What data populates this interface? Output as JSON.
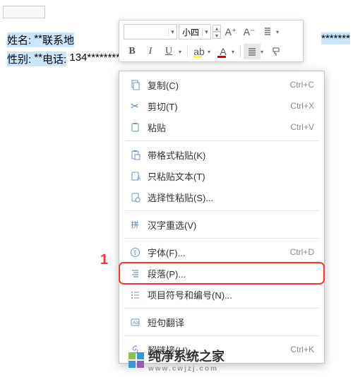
{
  "document": {
    "line1": {
      "name": "姓名:",
      "nv": " **",
      "addr": "联系地"
    },
    "line2": {
      "sex": "性别:",
      "sv": " **",
      "tel": "电话:",
      "num": " 134********"
    },
    "more_stars": "*******"
  },
  "toolbar": {
    "font_name": "",
    "font_size": "小四",
    "inc": "A⁺",
    "dec": "A⁻"
  },
  "menu": {
    "copy": {
      "label": "复制(C)",
      "shortcut": "Ctrl+C"
    },
    "cut": {
      "label": "剪切(T)",
      "shortcut": "Ctrl+X"
    },
    "paste": {
      "label": "粘贴",
      "shortcut": "Ctrl+V"
    },
    "pasteFmt": {
      "label": "带格式粘贴(K)",
      "shortcut": ""
    },
    "pasteText": {
      "label": "只粘贴文本(T)",
      "shortcut": ""
    },
    "pasteSel": {
      "label": "选择性粘贴(S)...",
      "shortcut": ""
    },
    "pinyin": {
      "label": "汉字重选(V)",
      "shortcut": ""
    },
    "font": {
      "label": "字体(F)...",
      "shortcut": "Ctrl+D"
    },
    "paragraph": {
      "label": "段落(P)...",
      "shortcut": ""
    },
    "bullets": {
      "label": "项目符号和编号(N)...",
      "shortcut": ""
    },
    "translate": {
      "label": "短句翻译",
      "shortcut": ""
    },
    "hyperlink": {
      "label": "超链接(H)...",
      "shortcut": "Ctrl+K"
    }
  },
  "marker": "1",
  "watermark": {
    "brand": "纯净系统之家",
    "url": "www.cwjzj.com"
  }
}
